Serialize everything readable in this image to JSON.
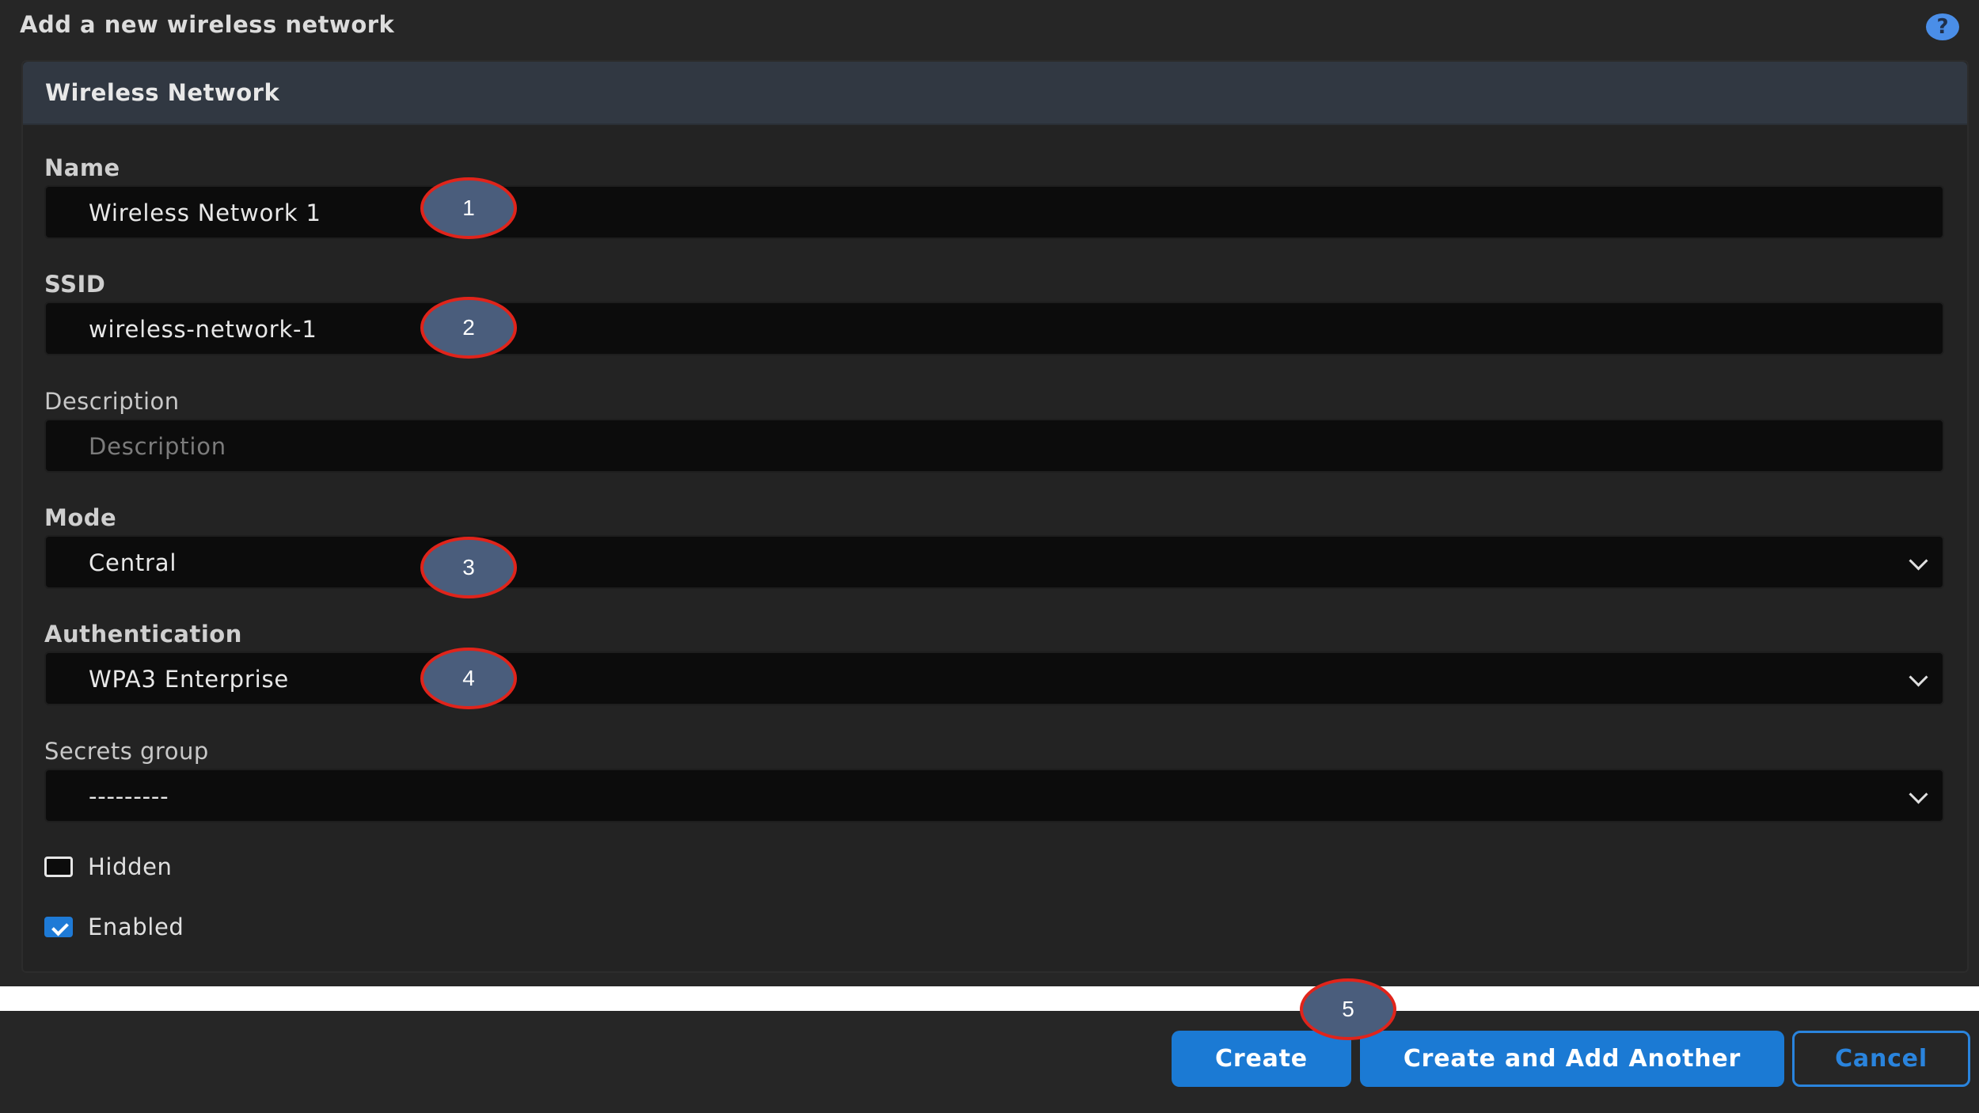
{
  "page": {
    "title": "Add a new wireless network",
    "help_icon": "?"
  },
  "panel": {
    "title": "Wireless Network"
  },
  "fields": {
    "name": {
      "label": "Name",
      "value": "Wireless Network 1"
    },
    "ssid": {
      "label": "SSID",
      "value": "wireless-network-1"
    },
    "description": {
      "label": "Description",
      "placeholder": "Description"
    },
    "mode": {
      "label": "Mode",
      "value": "Central"
    },
    "authentication": {
      "label": "Authentication",
      "value": "WPA3 Enterprise"
    },
    "secrets_group": {
      "label": "Secrets group",
      "value": "---------"
    }
  },
  "checkboxes": {
    "hidden": {
      "label": "Hidden",
      "checked": false
    },
    "enabled": {
      "label": "Enabled",
      "checked": true
    }
  },
  "buttons": {
    "create": "Create",
    "create_another": "Create and Add Another",
    "cancel": "Cancel"
  },
  "markers": [
    "1",
    "2",
    "3",
    "4",
    "5"
  ],
  "colors": {
    "primary": "#1b7ad4",
    "marker_fill": "#4a5d7c",
    "marker_border": "#e0241b",
    "background": "#262626"
  },
  "icons": {
    "help": "help-icon",
    "dropdown": "chevron-down-icon",
    "check": "checkmark-icon"
  }
}
